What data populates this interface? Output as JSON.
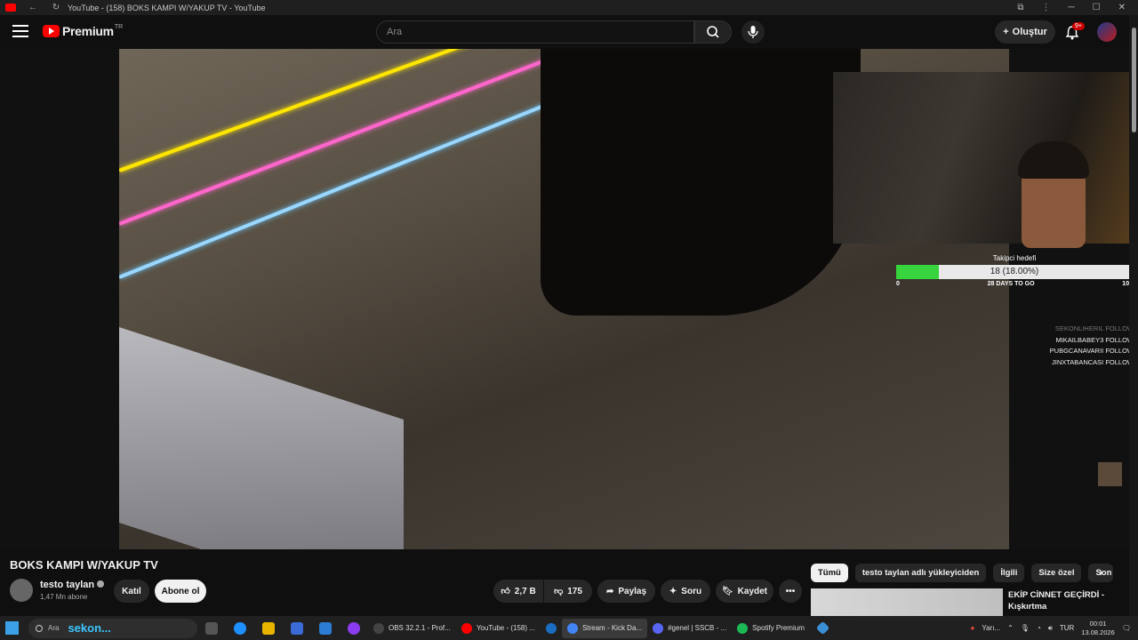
{
  "browser": {
    "tab_title": "YouTube - (158) BOKS KAMPI W/YAKUP TV - YouTube"
  },
  "header": {
    "logo_text": "Premium",
    "logo_region": "TR",
    "search_placeholder": "Ara",
    "create_label": "Oluştur",
    "notification_badge": "9+"
  },
  "overlay": {
    "goal_title": "Takipci hedefi",
    "goal_value": "18 (18.00%)",
    "goal_fraction": 0.18,
    "goal_min": "0",
    "goal_days": "28 DAYS TO GO",
    "goal_max": "100",
    "follows": [
      "SEKONLIHERIL  FOLLOW",
      "MIKAILBABEY3  FOLLOW",
      "PUBGCANAVARII  FOLLOW",
      "JINXTABANCASI  FOLLOW"
    ]
  },
  "video": {
    "title": "BOKS KAMPI W/YAKUP TV",
    "channel_name": "testo taylan",
    "subscribers": "1,47 Mn abone",
    "join_label": "Katıl",
    "subscribe_label": "Abone ol",
    "likes": "2,7 B",
    "dislikes": "175",
    "share_label": "Paylaş",
    "ask_label": "Soru",
    "save_label": "Kaydet"
  },
  "related": {
    "chips": [
      "Tümü",
      "testo taylan adlı yükleyiciden",
      "İlgili",
      "Size özel",
      "Son"
    ],
    "first_title": "EKİP CİNNET GEÇİRDİ - Kışkırtma"
  },
  "taskbar": {
    "search_label": "Ara",
    "search_widget": "sekon...",
    "apps": [
      {
        "label": "OBS 32.2.1 - Prof...",
        "color": "#444444"
      },
      {
        "label": "YouTube - (158) ...",
        "color": "#ff0000"
      },
      {
        "label": "",
        "color": "#1b6dc1"
      },
      {
        "label": "Stream - Kick Da...",
        "color": "#4285f4"
      },
      {
        "label": "#genel | SSCB - ...",
        "color": "#5865f2"
      },
      {
        "label": "Spotify Premium",
        "color": "#1db954"
      }
    ],
    "weather": "Yarı...",
    "language": "TUR",
    "time": "00:01",
    "date": "13.08.2026"
  }
}
